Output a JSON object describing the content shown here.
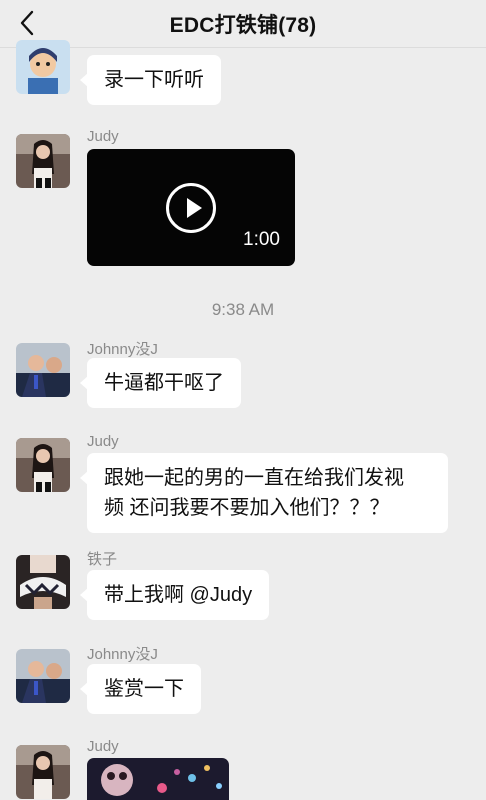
{
  "header": {
    "title": "EDC打铁铺(78)",
    "back_icon": "chevron-left-icon"
  },
  "messages": [
    {
      "sender": "",
      "text": "录一下听听"
    },
    {
      "sender": "Judy",
      "video_duration": "1:00"
    },
    {
      "sender": "Johnny没J",
      "text": "牛逼都干呕了"
    },
    {
      "sender": "Judy",
      "text_line1": "跟她一起的男的一直在给我们发视",
      "text_line2": "频 还问我要不要加入他们？？？"
    },
    {
      "sender": "铁子",
      "text": "带上我啊 @Judy"
    },
    {
      "sender": "Johnny没J",
      "text": "鉴赏一下"
    },
    {
      "sender": "Judy",
      "type": "image"
    }
  ],
  "timestamp": "9:38 AM",
  "colors": {
    "background": "#ededed",
    "bubble": "#ffffff",
    "sender_text": "#8a8a8a",
    "video_bg": "#050505"
  }
}
